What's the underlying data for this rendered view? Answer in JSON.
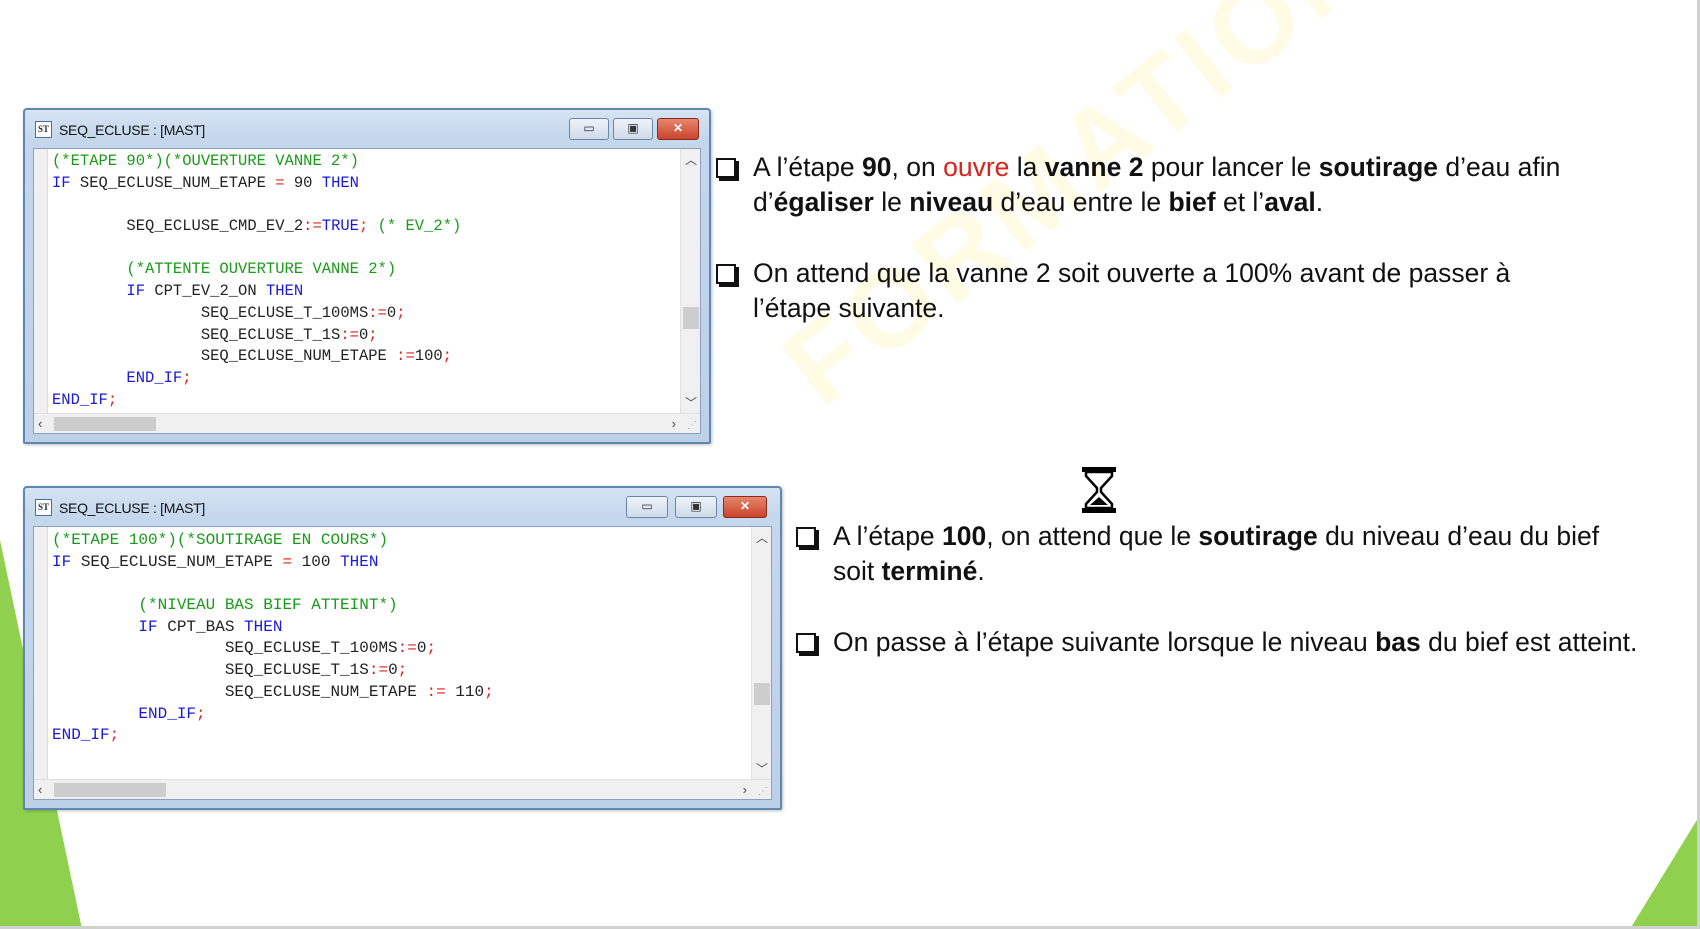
{
  "watermark": "FORMATION OUEST",
  "windows": [
    {
      "title": "SEQ_ECLUSE : [MAST]",
      "app_icon": "ST",
      "code_lines": [
        [
          {
            "t": "(*ETAPE 90*)(*OUVERTURE VANNE 2*)",
            "c": "comment"
          }
        ],
        [
          {
            "t": "IF ",
            "c": "kw"
          },
          {
            "t": "SEQ_ECLUSE_NUM_ETAPE ",
            "c": "plain"
          },
          {
            "t": "=",
            "c": "op"
          },
          {
            "t": " 90 ",
            "c": "plain"
          },
          {
            "t": "THEN",
            "c": "kw"
          }
        ],
        [],
        [
          {
            "t": "        SEQ_ECLUSE_CMD_EV_2",
            "c": "plain"
          },
          {
            "t": ":=",
            "c": "op"
          },
          {
            "t": "TRUE",
            "c": "kw"
          },
          {
            "t": "; ",
            "c": "op"
          },
          {
            "t": "(* EV_2*)",
            "c": "comment"
          }
        ],
        [],
        [
          {
            "t": "        (*ATTENTE OUVERTURE VANNE 2*)",
            "c": "comment"
          }
        ],
        [
          {
            "t": "        IF ",
            "c": "kw"
          },
          {
            "t": "CPT_EV_2_ON ",
            "c": "plain"
          },
          {
            "t": "THEN",
            "c": "kw"
          }
        ],
        [
          {
            "t": "                SEQ_ECLUSE_T_100MS",
            "c": "plain"
          },
          {
            "t": ":=",
            "c": "op"
          },
          {
            "t": "0",
            "c": "plain"
          },
          {
            "t": ";",
            "c": "op"
          }
        ],
        [
          {
            "t": "                SEQ_ECLUSE_T_1S",
            "c": "plain"
          },
          {
            "t": ":=",
            "c": "op"
          },
          {
            "t": "0",
            "c": "plain"
          },
          {
            "t": ";",
            "c": "op"
          }
        ],
        [
          {
            "t": "                SEQ_ECLUSE_NUM_ETAPE ",
            "c": "plain"
          },
          {
            "t": ":=",
            "c": "op"
          },
          {
            "t": "100",
            "c": "plain"
          },
          {
            "t": ";",
            "c": "op"
          }
        ],
        [
          {
            "t": "        END_IF",
            "c": "kw"
          },
          {
            "t": ";",
            "c": "op"
          }
        ],
        [
          {
            "t": "END_IF",
            "c": "kw"
          },
          {
            "t": ";",
            "c": "op"
          }
        ]
      ]
    },
    {
      "title": "SEQ_ECLUSE : [MAST]",
      "app_icon": "ST",
      "code_lines": [
        [
          {
            "t": "(*ETAPE 100*)(*SOUTIRAGE EN COURS*)",
            "c": "comment"
          }
        ],
        [
          {
            "t": "IF ",
            "c": "kw"
          },
          {
            "t": "SEQ_ECLUSE_NUM_ETAPE ",
            "c": "plain"
          },
          {
            "t": "=",
            "c": "op"
          },
          {
            "t": " 100 ",
            "c": "plain"
          },
          {
            "t": "THEN",
            "c": "kw"
          }
        ],
        [],
        [
          {
            "t": "         (*NIVEAU BAS BIEF ATTEINT*)",
            "c": "comment"
          }
        ],
        [
          {
            "t": "         IF ",
            "c": "kw"
          },
          {
            "t": "CPT_BAS ",
            "c": "plain"
          },
          {
            "t": "THEN",
            "c": "kw"
          }
        ],
        [
          {
            "t": "                  SEQ_ECLUSE_T_100MS",
            "c": "plain"
          },
          {
            "t": ":=",
            "c": "op"
          },
          {
            "t": "0",
            "c": "plain"
          },
          {
            "t": ";",
            "c": "op"
          }
        ],
        [
          {
            "t": "                  SEQ_ECLUSE_T_1S",
            "c": "plain"
          },
          {
            "t": ":=",
            "c": "op"
          },
          {
            "t": "0",
            "c": "plain"
          },
          {
            "t": ";",
            "c": "op"
          }
        ],
        [
          {
            "t": "                  SEQ_ECLUSE_NUM_ETAPE ",
            "c": "plain"
          },
          {
            "t": ":=",
            "c": "op"
          },
          {
            "t": " 110",
            "c": "plain"
          },
          {
            "t": ";",
            "c": "op"
          }
        ],
        [
          {
            "t": "         END_IF",
            "c": "kw"
          },
          {
            "t": ";",
            "c": "op"
          }
        ],
        [
          {
            "t": "END_IF",
            "c": "kw"
          },
          {
            "t": ";",
            "c": "op"
          }
        ]
      ]
    }
  ],
  "bullets_top": [
    [
      {
        "t": "A l’étape "
      },
      {
        "t": "90",
        "s": "b"
      },
      {
        "t": ", on "
      },
      {
        "t": "ouvre",
        "s": "red"
      },
      {
        "t": " la "
      },
      {
        "t": "vanne 2",
        "s": "b"
      },
      {
        "t": " pour lancer le "
      },
      {
        "t": "soutirage",
        "s": "b"
      },
      {
        "t": " d’eau afin d’"
      },
      {
        "t": "égaliser",
        "s": "b"
      },
      {
        "t": " le "
      },
      {
        "t": "niveau",
        "s": "b"
      },
      {
        "t": " d’eau entre le "
      },
      {
        "t": "bief",
        "s": "b"
      },
      {
        "t": " et l’"
      },
      {
        "t": "aval",
        "s": "b"
      },
      {
        "t": "."
      }
    ],
    [
      {
        "t": "On attend que la vanne 2 soit ouverte a 100% avant de passer à l’étape suivante."
      }
    ]
  ],
  "bullets_bottom": [
    [
      {
        "t": "A l’étape "
      },
      {
        "t": "100",
        "s": "b"
      },
      {
        "t": ", on attend que le "
      },
      {
        "t": "soutirage",
        "s": "b"
      },
      {
        "t": " du niveau d’eau du bief soit "
      },
      {
        "t": "terminé",
        "s": "b"
      },
      {
        "t": "."
      }
    ],
    [
      {
        "t": "On passe à l’étape suivante lorsque le niveau "
      },
      {
        "t": "bas",
        "s": "b"
      },
      {
        "t": " du bief est atteint."
      }
    ]
  ],
  "icons": {
    "hourglass": "hourglass-icon",
    "bullet": "checkbox-bullet-icon",
    "minimize": "minimize-icon",
    "maximize": "maximize-icon",
    "close": "close-icon"
  },
  "colors": {
    "accent_green": "#8fd14f",
    "comment": "#1a9a1a",
    "keyword": "#1a1ad8",
    "operator": "#e02020",
    "highlight_red": "#d8221a"
  }
}
